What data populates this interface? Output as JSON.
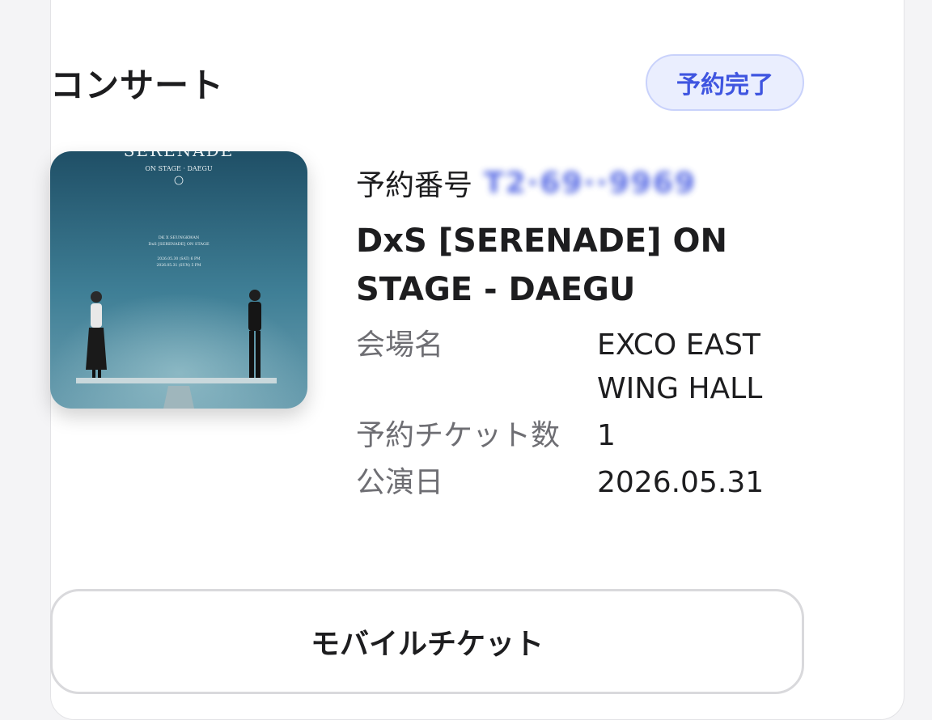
{
  "colors": {
    "accent": "#3f55e0",
    "badge_bg": "#eaeefe",
    "label": "#6e6e73",
    "text": "#1d1d1f"
  },
  "card": {
    "category": "コンサート",
    "status": "予約完了"
  },
  "poster": {
    "title": "SERENADE",
    "subtitle": "ON STAGE · DAEGU",
    "line1": "DK X SEUNGKWAN",
    "line2": "DxS [SERENADE] ON STAGE",
    "date1": "2026.05.30 (SAT) 6 PM",
    "date2": "2026.05.31 (SUN) 5 PM"
  },
  "reservation": {
    "label": "予約番号",
    "number": "T2·69··9969"
  },
  "event": {
    "title": "DxS [SERENADE] ON STAGE - DAEGU"
  },
  "details": [
    {
      "label": "会場名",
      "value": "EXCO EAST WING HALL"
    },
    {
      "label": "予約チケット数",
      "value": "1"
    },
    {
      "label": "公演日",
      "value": "2026.05.31"
    }
  ],
  "actions": {
    "mobile_ticket": "モバイルチケット"
  }
}
